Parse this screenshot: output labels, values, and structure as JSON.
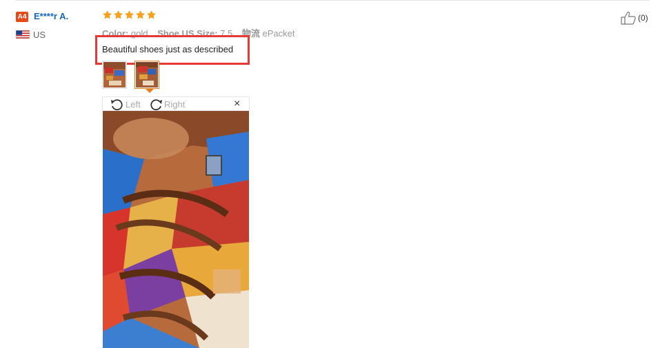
{
  "review": {
    "level_badge": "A4",
    "reviewer_name": "E****r A.",
    "country": "US",
    "rating": 5,
    "attributes": [
      {
        "key": "Color:",
        "value": "gold"
      },
      {
        "key": "Shoe US Size:",
        "value": "7.5"
      },
      {
        "key": "物流",
        "value": "ePacket"
      }
    ],
    "feedback": "Beautiful shoes just as described",
    "helpful_count": "(0)"
  },
  "viewer": {
    "rotate_left_label": "Left",
    "rotate_right_label": "Right",
    "close_label": "×"
  },
  "colors": {
    "accent_red": "#e53935",
    "star": "#f8a01a",
    "link": "#1566c0",
    "selected_thumb": "#e67e22"
  }
}
